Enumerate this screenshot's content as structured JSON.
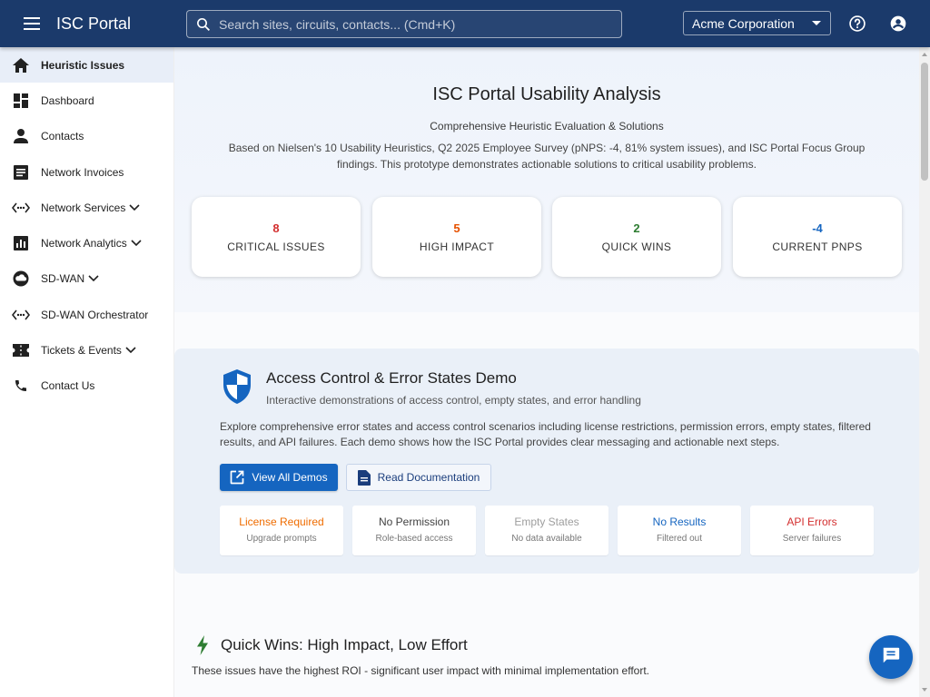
{
  "header": {
    "app_title": "ISC Portal",
    "search_placeholder": "Search sites, circuits, contacts... (Cmd+K)",
    "org_selected": "Acme Corporation",
    "icons": [
      "menu-icon",
      "search-icon",
      "help-icon",
      "account-icon"
    ]
  },
  "sidebar": {
    "items": [
      {
        "label": "Heuristic Issues",
        "icon": "home-icon",
        "active": true
      },
      {
        "label": "Dashboard",
        "icon": "dashboard-icon"
      },
      {
        "label": "Contacts",
        "icon": "person-icon"
      },
      {
        "label": "Network Invoices",
        "icon": "invoice-icon"
      },
      {
        "label": "Network Services",
        "icon": "settings-ethernet-icon",
        "expandable": true
      },
      {
        "label": "Network Analytics",
        "icon": "analytics-icon",
        "expandable": true
      },
      {
        "label": "SD-WAN",
        "icon": "cloud-icon",
        "expandable": true
      },
      {
        "label": "SD-WAN Orchestrator",
        "icon": "settings-ethernet-icon"
      },
      {
        "label": "Tickets & Events",
        "icon": "ticket-icon",
        "expandable": true
      },
      {
        "label": "Contact Us",
        "icon": "phone-icon"
      }
    ]
  },
  "hero": {
    "title": "ISC Portal Usability Analysis",
    "subtitle": "Comprehensive Heuristic Evaluation & Solutions",
    "description": "Based on Nielsen's 10 Usability Heuristics, Q2 2025 Employee Survey (pNPS: -4, 81% system issues), and ISC Portal Focus Group findings. This prototype demonstrates actionable solutions to critical usability problems.",
    "stats": [
      {
        "value": "8",
        "label": "CRITICAL ISSUES",
        "color": "#d32f2f"
      },
      {
        "value": "5",
        "label": "HIGH IMPACT",
        "color": "#e65100"
      },
      {
        "value": "2",
        "label": "QUICK WINS",
        "color": "#2e7d32"
      },
      {
        "value": "-4",
        "label": "CURRENT PNPS",
        "color": "#1565c0"
      }
    ]
  },
  "access": {
    "title": "Access Control & Error States Demo",
    "subtitle": "Interactive demonstrations of access control, empty states, and error handling",
    "description": "Explore comprehensive error states and access control scenarios including license restrictions, permission errors, empty states, filtered results, and API failures. Each demo shows how the ISC Portal provides clear messaging and actionable next steps.",
    "primary_button": "View All Demos",
    "secondary_button": "Read Documentation",
    "demos": [
      {
        "title": "License Required",
        "sub": "Upgrade prompts",
        "color": "#ef6c00"
      },
      {
        "title": "No Permission",
        "sub": "Role-based access",
        "color": "#424242"
      },
      {
        "title": "Empty States",
        "sub": "No data available",
        "color": "#9e9e9e"
      },
      {
        "title": "No Results",
        "sub": "Filtered out",
        "color": "#1565c0"
      },
      {
        "title": "API Errors",
        "sub": "Server failures",
        "color": "#d32f2f"
      }
    ]
  },
  "quick_wins": {
    "title": "Quick Wins: High Impact, Low Effort",
    "description": "These issues have the highest ROI - significant user impact with minimal implementation effort."
  },
  "colors": {
    "topbar": "#1b3a6b",
    "accent": "#1565c0",
    "bolt": "#2e7d32"
  }
}
